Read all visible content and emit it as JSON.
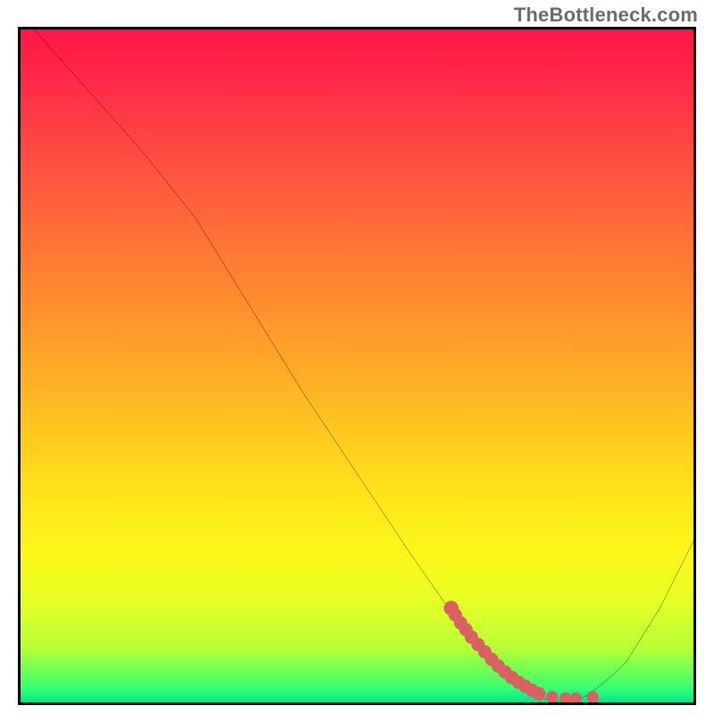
{
  "watermark": "TheBottleneck.com",
  "colors": {
    "frame_border": "#000000",
    "curve": "#000000",
    "marker": "#d86262",
    "gradient_top": "#ff1649",
    "gradient_bottom": "#00e490"
  },
  "chart_data": {
    "type": "line",
    "title": "",
    "xlabel": "",
    "ylabel": "",
    "xlim": [
      0,
      100
    ],
    "ylim": [
      0,
      100
    ],
    "grid": false,
    "legend": false,
    "series": [
      {
        "name": "bottleneck-curve",
        "x": [
          2,
          10,
          18,
          26,
          34,
          42,
          50,
          58,
          65,
          70,
          75,
          79,
          82,
          85,
          90,
          95,
          100
        ],
        "y": [
          100,
          91,
          82,
          72,
          59,
          46,
          34,
          22,
          12,
          6,
          2,
          0,
          0,
          1,
          6,
          14,
          24
        ]
      }
    ],
    "markers": {
      "name": "highlight-points",
      "color": "#d86262",
      "x": [
        64,
        66,
        68,
        70,
        72,
        74,
        76,
        78,
        80,
        82,
        85
      ],
      "y": [
        14,
        11,
        9,
        6,
        4,
        3,
        2,
        1,
        0.5,
        0.5,
        0.8
      ]
    }
  }
}
